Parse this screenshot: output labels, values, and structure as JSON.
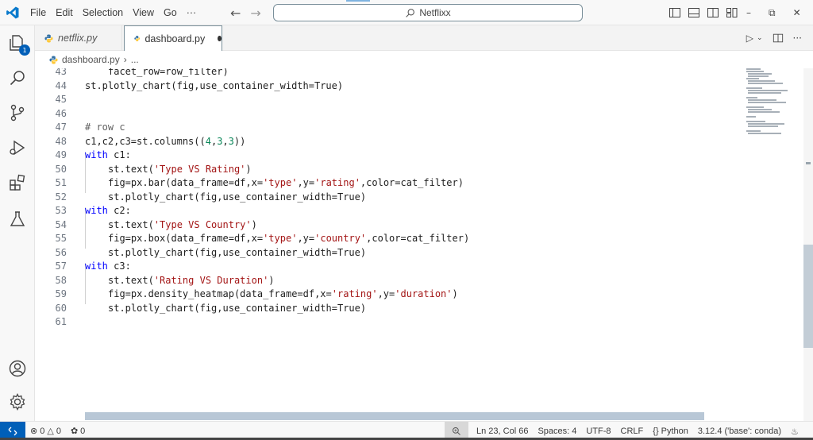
{
  "menu": [
    "File",
    "Edit",
    "Selection",
    "View",
    "Go",
    "···"
  ],
  "search": {
    "label": "Netflixx"
  },
  "tabs": [
    {
      "label": "netflix.py",
      "active": false
    },
    {
      "label": "dashboard.py",
      "active": true,
      "dirty": true
    }
  ],
  "breadcrumb": {
    "file": "dashboard.py",
    "rest": "..."
  },
  "activity_badge": "1",
  "code_lines": [
    {
      "n": "43",
      "indent": 1,
      "text": "facet_row=row_filter)"
    },
    {
      "n": "44",
      "indent": 0,
      "text": "st.plotly_chart(fig,use_container_width=True)"
    },
    {
      "n": "45",
      "indent": 0,
      "text": ""
    },
    {
      "n": "46",
      "indent": 0,
      "text": ""
    },
    {
      "n": "47",
      "indent": 0,
      "text": "# row c"
    },
    {
      "n": "48",
      "indent": 0,
      "text": "c1,c2,c3=st.columns((4,3,3))"
    },
    {
      "n": "49",
      "indent": 0,
      "text": "with c1:"
    },
    {
      "n": "50",
      "indent": 1,
      "text": "st.text('Type VS Rating')"
    },
    {
      "n": "51",
      "indent": 1,
      "text": "fig=px.bar(data_frame=df,x='type',y='rating',color=cat_filter)"
    },
    {
      "n": "52",
      "indent": 1,
      "text": "st.plotly_chart(fig,use_container_width=True)"
    },
    {
      "n": "53",
      "indent": 0,
      "text": "with c2:"
    },
    {
      "n": "54",
      "indent": 1,
      "text": "st.text('Type VS Country')"
    },
    {
      "n": "55",
      "indent": 1,
      "text": "fig=px.box(data_frame=df,x='type',y='country',color=cat_filter)"
    },
    {
      "n": "56",
      "indent": 1,
      "text": "st.plotly_chart(fig,use_container_width=True)"
    },
    {
      "n": "57",
      "indent": 0,
      "text": "with c3:"
    },
    {
      "n": "58",
      "indent": 1,
      "text": "st.text('Rating VS Duration')"
    },
    {
      "n": "59",
      "indent": 1,
      "text": "fig=px.density_heatmap(data_frame=df,x='rating',y='duration')"
    },
    {
      "n": "60",
      "indent": 1,
      "text": "st.plotly_chart(fig,use_container_width=True)"
    },
    {
      "n": "61",
      "indent": 0,
      "text": ""
    }
  ],
  "status": {
    "errors": "0",
    "warnings": "0",
    "ports": "0",
    "position": "Ln 23, Col 66",
    "spaces": "Spaces: 4",
    "encoding": "UTF-8",
    "eol": "CRLF",
    "language": "Python",
    "interpreter": "3.12.4 ('base': conda)"
  },
  "colors": {
    "accent": "#005fb8",
    "keyword": "#0000ff",
    "string": "#a31515"
  }
}
